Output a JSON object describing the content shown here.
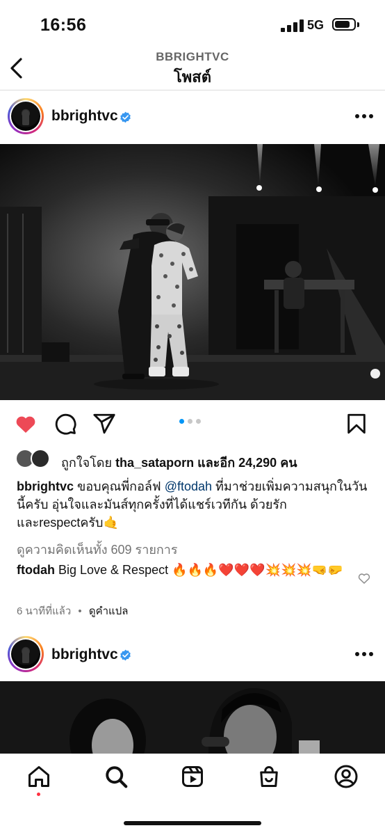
{
  "status_bar": {
    "time": "16:56",
    "network": "5G",
    "battery_level": 0.8
  },
  "header": {
    "username": "BBRIGHTVC",
    "title": "โพสต์",
    "back_icon": "chevron-left-icon"
  },
  "post": {
    "username": "bbrightvc",
    "verified": true,
    "carousel": {
      "count": 3,
      "active_index": 0
    },
    "liked": true,
    "likes": {
      "prefix": "ถูกใจโดย",
      "user": "tha_sataporn",
      "and_others": "และอีก",
      "count": "24,290",
      "suffix": "คน"
    },
    "caption": {
      "username": "bbrightvc",
      "before_mention": "ขอบคุณพี่กอล์ฟ",
      "mention": "@ftodah",
      "after_mention": "ที่มาช่วยเพิ่มความสนุกในวันนี้ครับ อุ่นใจและมันส์ทุกครั้งที่ได้แชร์เวทีกัน ด้วยรักและrespectครับ🤙"
    },
    "view_comments": "ดูความคิดเห็นทั้ง 609 รายการ",
    "top_comment": {
      "username": "ftodah",
      "text": "Big Love & Respect 🔥🔥🔥❤️❤️❤️💥💥💥🤜🤛"
    },
    "time_ago": "6 นาทีที่แล้ว",
    "separator": "•",
    "translate": "ดูคำแปล"
  },
  "next_post": {
    "username": "bbrightvc",
    "verified": true
  },
  "tab_bar": {
    "items": [
      "home-icon",
      "search-icon",
      "reels-icon",
      "shop-icon",
      "profile-icon"
    ],
    "active": "home-icon"
  },
  "colors": {
    "like_red": "#ed4956",
    "verified_blue": "#3897f0",
    "mention_blue": "#00376b",
    "dot_active": "#0095f6",
    "dot_inactive": "#c7c7c7"
  }
}
